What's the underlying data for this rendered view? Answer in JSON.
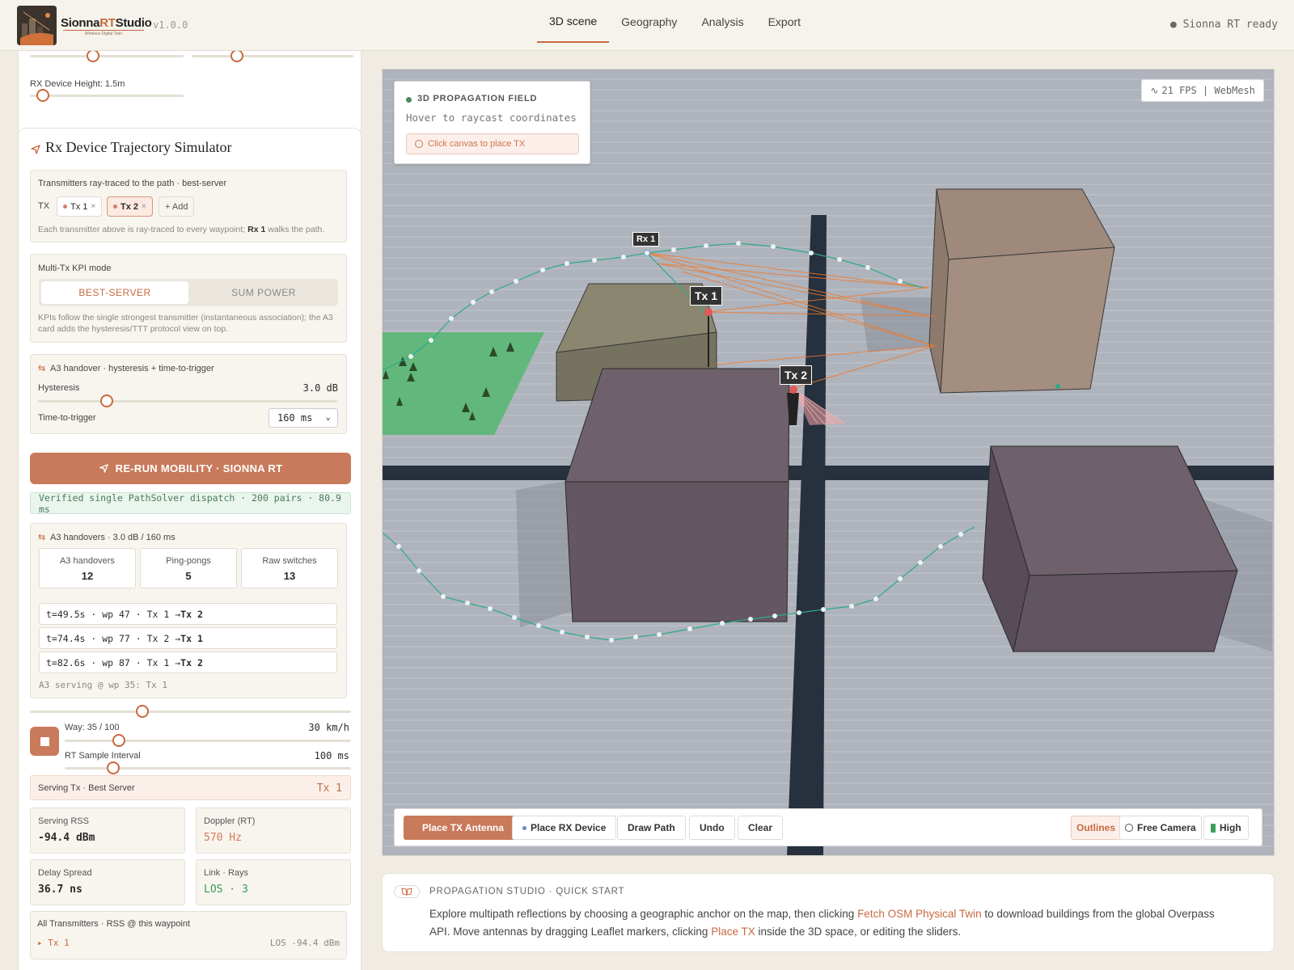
{
  "header": {
    "brand_a": "Sionna",
    "brand_b": "RT",
    "brand_c": "Studio",
    "brand_sub": "Wireless Digital Twin",
    "version": "v1.0.0",
    "tabs": [
      "3D scene",
      "Geography",
      "Analysis",
      "Export"
    ],
    "status": "● Sionna RT ready"
  },
  "top_card": {
    "rx_height_label": "RX Device Height: 1.5m"
  },
  "trajectory": {
    "title": "Rx Device Trajectory Simulator",
    "tx_section": {
      "title": "Transmitters ray-traced to the path · best-server",
      "tx_label": "TX",
      "chips": [
        {
          "name": "Tx 1",
          "color": "#d97a6a"
        },
        {
          "name": "Tx 2",
          "color": "#d97a6a"
        }
      ],
      "add_label": "+ Add",
      "help_a": "Each transmitter above is ray-traced to every waypoint;",
      "help_b": "Rx 1",
      "help_c": "walks the path."
    },
    "kpi_mode": {
      "title": "Multi-Tx KPI mode",
      "option_on": "BEST-SERVER",
      "option_off": "SUM POWER",
      "help": "KPIs follow the single strongest transmitter (instantaneous association); the A3 card adds the hysteresis/TTT protocol view on top."
    },
    "a3": {
      "title": "A3 handover · hysteresis + time-to-trigger",
      "hysteresis_label": "Hysteresis",
      "hysteresis_value": "3.0 dB",
      "hysteresis_level": 0.23,
      "ttt_label": "Time-to-trigger",
      "ttt_value": "160 ms"
    },
    "rerun_label": "RE-RUN MOBILITY · SIONNA RT",
    "verify_text": "Verified single PathSolver dispatch · 200 pairs · 80.9 ms",
    "handovers": {
      "title": "A3 handovers · 3.0 dB / 160 ms",
      "stats": [
        {
          "label": "A3 handovers",
          "value": "12"
        },
        {
          "label": "Ping-pongs",
          "value": "5"
        },
        {
          "label": "Raw switches",
          "value": "13"
        }
      ],
      "events": [
        {
          "text": "t=49.5s · wp 47 · Tx 1 → ",
          "to": "Tx 2"
        },
        {
          "text": "t=74.4s · wp 77 · Tx 2 → ",
          "to": "Tx 1"
        },
        {
          "text": "t=82.6s · wp 87 · Tx 1 → ",
          "to": "Tx 2"
        }
      ],
      "serving_note": "A3 serving @ wp 35: Tx 1"
    },
    "playback": {
      "progress": 0.35,
      "way_label": "Way: 35 / 100",
      "speed": "30 km/h",
      "interval_label": "RT Sample Interval",
      "interval_value": "100 ms"
    },
    "serving": {
      "label": "Serving Tx · Best Server",
      "value": "Tx 1"
    },
    "kpis": [
      {
        "label": "Serving RSS",
        "value": "-94.4 dBm",
        "accent": false
      },
      {
        "label": "Doppler (RT)",
        "value": "570 Hz",
        "accent": true
      },
      {
        "label": "Delay Spread",
        "value": "36.7 ns",
        "accent": false
      },
      {
        "label": "Link · Rays",
        "value": "LOS · 3",
        "accent": true
      }
    ],
    "all_tx": {
      "title": "All Transmitters · RSS @ this waypoint",
      "row_name": "▸ Tx 1",
      "row_value": "LOS -94.4 dBm"
    }
  },
  "scene": {
    "info_title": "3D PROPAGATION FIELD",
    "info_hint": "Hover to raycast coordinates",
    "info_button": "Click canvas to place TX",
    "fps": "21 FPS | WebMesh",
    "labels": {
      "rx1": "Rx 1",
      "tx1": "Tx 1",
      "tx2": "Tx 2"
    },
    "toolbar": {
      "place_tx": "Place TX Antenna",
      "place_rx": "Place RX Device",
      "draw_path": "Draw Path",
      "undo": "Undo",
      "clear": "Clear",
      "outlines": "Outlines",
      "free_camera": "Free Camera",
      "quality": "High"
    }
  },
  "quick_start": {
    "title": "PROPAGATION STUDIO · QUICK START",
    "t1": "Explore multipath reflections by choosing a geographic anchor on the map, then clicking ",
    "link1": "Fetch OSM Physical Twin",
    "t2": " to download buildings from the global Overpass",
    "t3": "API. Move antennas by dragging Leaflet markers, clicking ",
    "link2": "Place TX",
    "t4": " inside the 3D space, or editing the sliders."
  },
  "colors": {
    "accent": "#c8693f",
    "button": "#c97a5b",
    "path_line": "#2eaa8a",
    "ray": "#f07a2a"
  }
}
